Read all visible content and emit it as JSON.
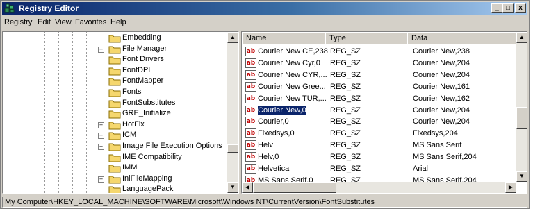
{
  "window": {
    "title": "Registry Editor"
  },
  "title_buttons": {
    "minimize": "_",
    "maximize": "□",
    "close": "x"
  },
  "menu": [
    "Registry",
    "Edit",
    "View",
    "Favorites",
    "Help"
  ],
  "tree": [
    {
      "label": "Embedding",
      "expander": ""
    },
    {
      "label": "File Manager",
      "expander": "+"
    },
    {
      "label": "Font Drivers",
      "expander": ""
    },
    {
      "label": "FontDPI",
      "expander": ""
    },
    {
      "label": "FontMapper",
      "expander": ""
    },
    {
      "label": "Fonts",
      "expander": ""
    },
    {
      "label": "FontSubstitutes",
      "expander": ""
    },
    {
      "label": "GRE_Initialize",
      "expander": ""
    },
    {
      "label": "HotFix",
      "expander": "+"
    },
    {
      "label": "ICM",
      "expander": "+"
    },
    {
      "label": "Image File Execution Options",
      "expander": "+"
    },
    {
      "label": "IME Compatibility",
      "expander": ""
    },
    {
      "label": "IMM",
      "expander": ""
    },
    {
      "label": "IniFileMapping",
      "expander": "+"
    },
    {
      "label": "LanguagePack",
      "expander": ""
    }
  ],
  "list": {
    "columns": {
      "name": "Name",
      "type": "Type",
      "data": "Data"
    },
    "icon_text": "ab",
    "rows": [
      {
        "name": "Courier New CE,238",
        "type": "REG_SZ",
        "data": "Courier New,238"
      },
      {
        "name": "Courier New Cyr,0",
        "type": "REG_SZ",
        "data": "Courier New,204"
      },
      {
        "name": "Courier New CYR,...",
        "type": "REG_SZ",
        "data": "Courier New,204"
      },
      {
        "name": "Courier New Gree...",
        "type": "REG_SZ",
        "data": "Courier New,161"
      },
      {
        "name": "Courier New TUR,...",
        "type": "REG_SZ",
        "data": "Courier New,162"
      },
      {
        "name": "Courier New,0",
        "type": "REG_SZ",
        "data": "Courier New,204",
        "selected": true
      },
      {
        "name": "Courier,0",
        "type": "REG_SZ",
        "data": "Courier New,204"
      },
      {
        "name": "Fixedsys,0",
        "type": "REG_SZ",
        "data": "Fixedsys,204"
      },
      {
        "name": "Helv",
        "type": "REG_SZ",
        "data": "MS Sans Serif"
      },
      {
        "name": "Helv,0",
        "type": "REG_SZ",
        "data": "MS Sans Serif,204"
      },
      {
        "name": "Helvetica",
        "type": "REG_SZ",
        "data": "Arial"
      },
      {
        "name": "MS Sans Serif,0",
        "type": "REG_SZ",
        "data": "MS Sans Serif,204"
      }
    ]
  },
  "status": "My Computer\\HKEY_LOCAL_MACHINE\\SOFTWARE\\Microsoft\\Windows NT\\CurrentVersion\\FontSubstitutes"
}
